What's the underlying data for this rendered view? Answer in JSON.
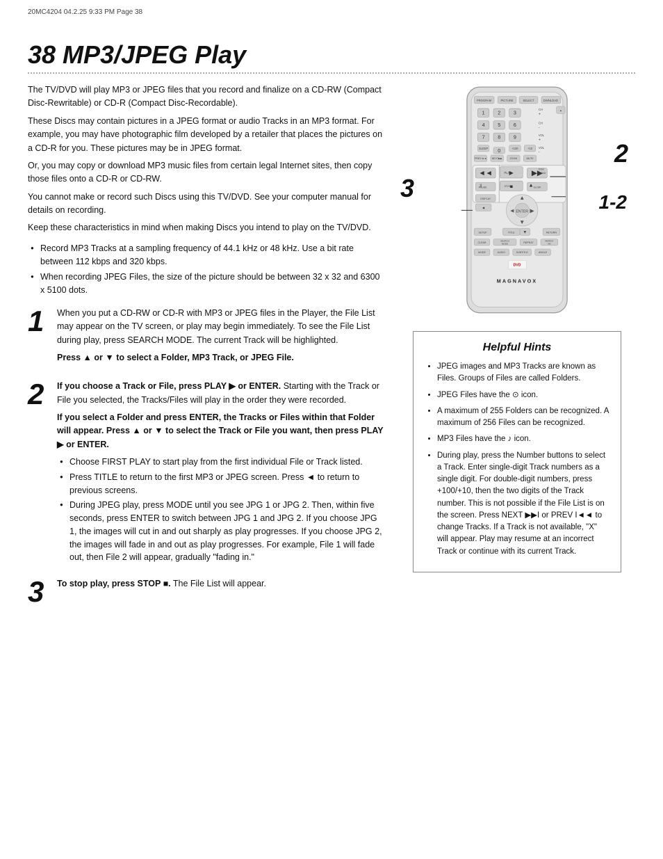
{
  "header": {
    "meta": "20MC4204  04.2.25  9:33 PM  Page 38",
    "title": "38  MP3/JPEG Play"
  },
  "intro": {
    "paragraphs": [
      "The TV/DVD will play MP3 or JPEG files that you record and finalize on a CD-RW (Compact Disc-Rewritable) or CD-R (Compact Disc-Recordable).",
      "These Discs may contain pictures in a JPEG format or audio Tracks in an MP3 format. For example, you may have photographic film developed by a retailer that places the pictures on a CD-R for you. These pictures may be in JPEG format.",
      "Or, you may copy or download MP3 music files from certain legal Internet sites, then copy those files onto a CD-R or CD-RW.",
      "You cannot make or record such Discs using this TV/DVD. See your computer manual for details on recording.",
      "Keep these characteristics in mind when making Discs you intend to play on the TV/DVD."
    ],
    "bullets": [
      "Record MP3 Tracks at a sampling frequency of 44.1 kHz or 48 kHz. Use a bit rate between 112 kbps and 320 kbps.",
      "When recording JPEG Files, the size of the picture should be between 32 x 32 and 6300 x 5100 dots."
    ]
  },
  "steps": [
    {
      "number": "1",
      "content": "When you put a CD-RW or CD-R with MP3 or JPEG files in the Player, the File List may appear on the TV screen, or play may begin immediately. To see the File List during play, press SEARCH MODE. The current Track will be highlighted.",
      "bold_line": "Press ▲ or ▼ to select a Folder, MP3 Track, or JPEG File."
    },
    {
      "number": "2",
      "intro_bold": "If you choose a Track or File, press PLAY ▶ or ENTER.",
      "intro_rest": " Starting with the Track or File you selected, the Tracks/Files will play in the order they were recorded.",
      "bold_block": "If you select a Folder and press ENTER, the Tracks or Files within that Folder will appear. Press ▲ or ▼ to select the Track or File you want, then press PLAY ▶ or ENTER.",
      "sub_bullets": [
        "Choose FIRST PLAY to start play from the first individual File or Track listed.",
        "Press TITLE to return to the first MP3 or JPEG screen. Press ◄ to return to previous screens.",
        "During JPEG play, press MODE until you see JPG 1 or JPG 2. Then, within five seconds, press ENTER to switch between JPG 1 and JPG 2. If you choose JPG 1, the images will cut in and out sharply as play progresses. If you choose JPG 2, the images will fade in and out as play progresses. For example, File 1 will fade out, then File 2 will appear, gradually \"fading in.\""
      ]
    },
    {
      "number": "3",
      "content": "To stop play, press STOP ■. The File List will appear."
    }
  ],
  "helpful_hints": {
    "title": "Helpful Hints",
    "hints": [
      "JPEG images and MP3 Tracks are known as Files. Groups of Files are called Folders.",
      "JPEG Files have the ⊙ icon.",
      "A maximum of 255 Folders can be recognized. A maximum of 256 Files can be recognized.",
      "MP3 Files have the ♪ icon.",
      "During play, press the Number buttons to select a Track. Enter single-digit Track numbers as a single digit. For double-digit numbers, press +100/+10, then the two digits of the Track number. This is not possible if the File List is on the screen. Press NEXT ▶▶I or PREV I◄◄ to change Tracks. If a Track is not available, \"X\" will appear. Play may resume at an incorrect Track or continue with its current Track."
    ]
  },
  "remote": {
    "label_2": "2",
    "label_3": "3",
    "label_1_2": "1-2",
    "brand": "MAGNAVOX"
  }
}
